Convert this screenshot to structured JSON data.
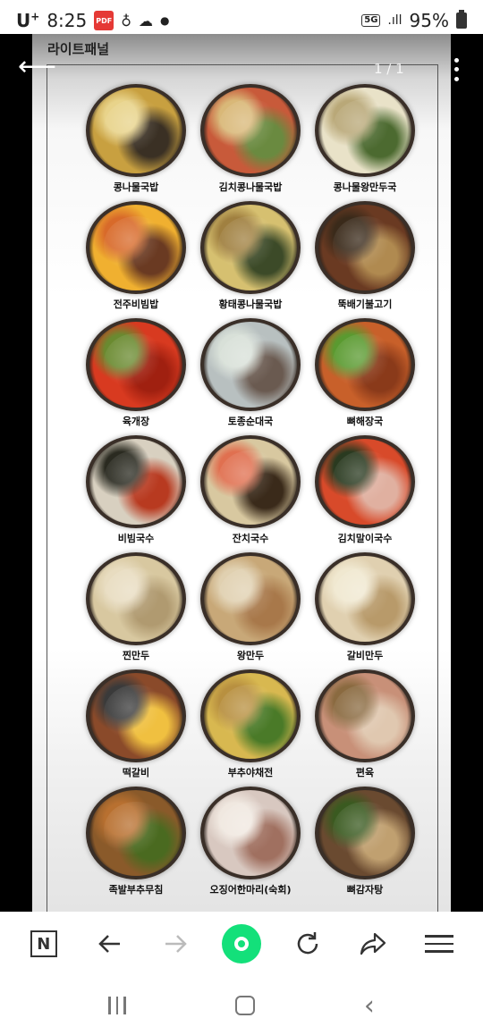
{
  "status_bar": {
    "carrier": "U",
    "carrier_sup": "+",
    "time": "8:25",
    "pdf_badge": "PDF",
    "network": "5G",
    "signal": ".ıll",
    "battery": "95%"
  },
  "viewer": {
    "page_title": "라이트패널",
    "page_indicator": "1 / 1"
  },
  "menu": {
    "items": [
      {
        "name": "콩나물국밥",
        "colors": [
          "#c8a040",
          "#3a3024",
          "#e8d38a"
        ]
      },
      {
        "name": "김치콩나물국밥",
        "colors": [
          "#c85a3a",
          "#6a8a40",
          "#d9b878"
        ]
      },
      {
        "name": "콩나물왕만두국",
        "colors": [
          "#e9e2c8",
          "#4c6a30",
          "#b9a878"
        ]
      },
      {
        "name": "전주비빔밥",
        "colors": [
          "#f0b030",
          "#6a3a22",
          "#d86a2a"
        ]
      },
      {
        "name": "황태콩나물국밥",
        "colors": [
          "#d6c070",
          "#3c4a28",
          "#a08040"
        ]
      },
      {
        "name": "뚝배기불고기",
        "colors": [
          "#6a3a22",
          "#b08a50",
          "#3a2a1a"
        ]
      },
      {
        "name": "육개장",
        "colors": [
          "#d83a20",
          "#a02010",
          "#6a8a30"
        ]
      },
      {
        "name": "토종순대국",
        "colors": [
          "#b8c0c0",
          "#6a5a50",
          "#d8e0d8"
        ]
      },
      {
        "name": "뼈해장국",
        "colors": [
          "#c8602a",
          "#8a3a1a",
          "#5a9a30"
        ]
      },
      {
        "name": "비빔국수",
        "colors": [
          "#d8d0c0",
          "#b83a20",
          "#2a2a20"
        ]
      },
      {
        "name": "잔치국수",
        "colors": [
          "#d8c8a0",
          "#3a2a1a",
          "#e07050"
        ]
      },
      {
        "name": "김치말이국수",
        "colors": [
          "#d84a2a",
          "#e0b0a0",
          "#2a3a20"
        ]
      },
      {
        "name": "찐만두",
        "colors": [
          "#d8c8a0",
          "#b09a70",
          "#e8dcc0"
        ]
      },
      {
        "name": "왕만두",
        "colors": [
          "#c8a878",
          "#a8784a",
          "#e0d0b0"
        ]
      },
      {
        "name": "갈비만두",
        "colors": [
          "#e0d0b0",
          "#b89a6a",
          "#f0e8d0"
        ]
      },
      {
        "name": "떡갈비",
        "colors": [
          "#8a4a2a",
          "#f0c040",
          "#3a3a3a"
        ]
      },
      {
        "name": "부추야채전",
        "colors": [
          "#d8b850",
          "#4a7a28",
          "#b89040"
        ]
      },
      {
        "name": "편육",
        "colors": [
          "#c89078",
          "#e0c8b0",
          "#8a6a40"
        ]
      },
      {
        "name": "족발부추무침",
        "colors": [
          "#8a5a2a",
          "#4a6a20",
          "#b87030"
        ]
      },
      {
        "name": "오징어한마리(숙회)",
        "colors": [
          "#d8c8c0",
          "#a07060",
          "#f0e8e0"
        ]
      },
      {
        "name": "뼈감자탕",
        "colors": [
          "#6a4a30",
          "#c0a070",
          "#3a5a20"
        ]
      }
    ]
  },
  "toolbar": {
    "n_label": "N"
  }
}
